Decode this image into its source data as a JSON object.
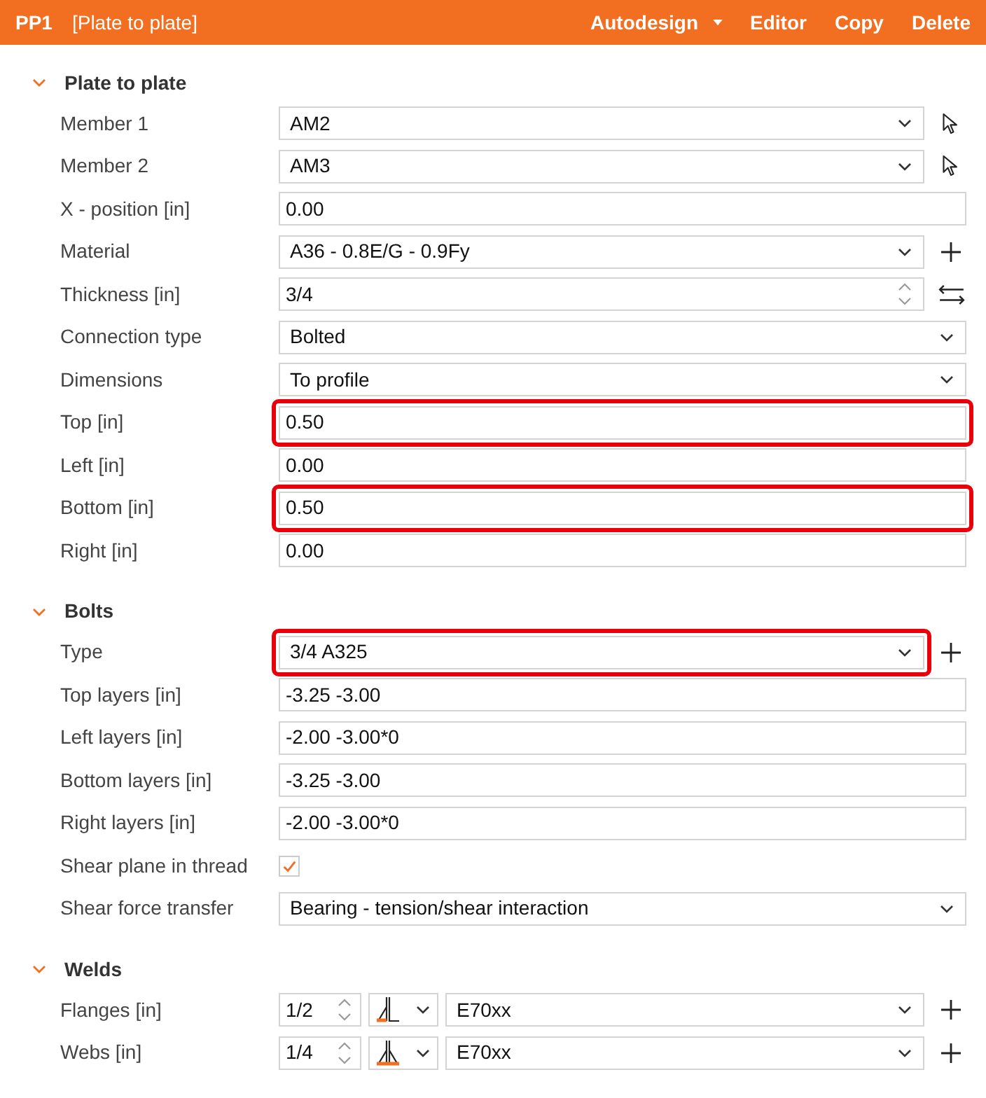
{
  "header": {
    "id": "PP1",
    "title": "[Plate to plate]",
    "actions": [
      {
        "label": "Autodesign",
        "dropdown": true
      },
      {
        "label": "Editor",
        "dropdown": false
      },
      {
        "label": "Copy",
        "dropdown": false
      },
      {
        "label": "Delete",
        "dropdown": false
      }
    ]
  },
  "sections": [
    {
      "title": "Plate to plate",
      "expanded": true,
      "rows": [
        {
          "kind": "select",
          "label": "Member 1",
          "value": "AM2",
          "action": {
            "kind": "pick"
          },
          "highlighted": false
        },
        {
          "kind": "select",
          "label": "Member 2",
          "value": "AM3",
          "action": {
            "kind": "pick"
          },
          "highlighted": false
        },
        {
          "kind": "text",
          "label": "X - position [in]",
          "value": "0.00",
          "highlighted": false
        },
        {
          "kind": "select",
          "label": "Material",
          "value": "A36 - 0.8E/G - 0.9Fy",
          "action": {
            "kind": "plus"
          },
          "highlighted": false
        },
        {
          "kind": "spinner",
          "label": "Thickness [in]",
          "value": "3/4",
          "action": {
            "kind": "swap"
          },
          "highlighted": false
        },
        {
          "kind": "select",
          "label": "Connection type",
          "value": "Bolted",
          "highlighted": false
        },
        {
          "kind": "select",
          "label": "Dimensions",
          "value": "To profile",
          "highlighted": false
        },
        {
          "kind": "text",
          "label": "Top [in]",
          "value": "0.50",
          "highlighted": true
        },
        {
          "kind": "text",
          "label": "Left [in]",
          "value": "0.00",
          "highlighted": false
        },
        {
          "kind": "text",
          "label": "Bottom [in]",
          "value": "0.50",
          "highlighted": true
        },
        {
          "kind": "text",
          "label": "Right [in]",
          "value": "0.00",
          "highlighted": false
        }
      ]
    },
    {
      "title": "Bolts",
      "expanded": true,
      "rows": [
        {
          "kind": "select",
          "label": "Type",
          "value": "3/4 A325",
          "action": {
            "kind": "plus"
          },
          "highlighted": true
        },
        {
          "kind": "text",
          "label": "Top layers [in]",
          "value": "-3.25 -3.00",
          "highlighted": false
        },
        {
          "kind": "text",
          "label": "Left layers [in]",
          "value": "-2.00 -3.00*0",
          "highlighted": false
        },
        {
          "kind": "text",
          "label": "Bottom layers [in]",
          "value": "-3.25 -3.00",
          "highlighted": false
        },
        {
          "kind": "text",
          "label": "Right layers [in]",
          "value": "-2.00 -3.00*0",
          "highlighted": false
        },
        {
          "kind": "checkbox",
          "label": "Shear plane in thread",
          "checked": true
        },
        {
          "kind": "select",
          "label": "Shear force transfer",
          "value": "Bearing - tension/shear interaction",
          "highlighted": false
        }
      ]
    },
    {
      "title": "Welds",
      "expanded": true,
      "rows": [
        {
          "kind": "weld",
          "label": "Flanges [in]",
          "size": "1/2",
          "weld": {
            "kind": "single"
          },
          "value": "E70xx",
          "action": {
            "kind": "plus"
          }
        },
        {
          "kind": "weld",
          "label": "Webs [in]",
          "size": "1/4",
          "weld": {
            "kind": "double"
          },
          "value": "E70xx",
          "action": {
            "kind": "plus"
          }
        }
      ]
    }
  ]
}
